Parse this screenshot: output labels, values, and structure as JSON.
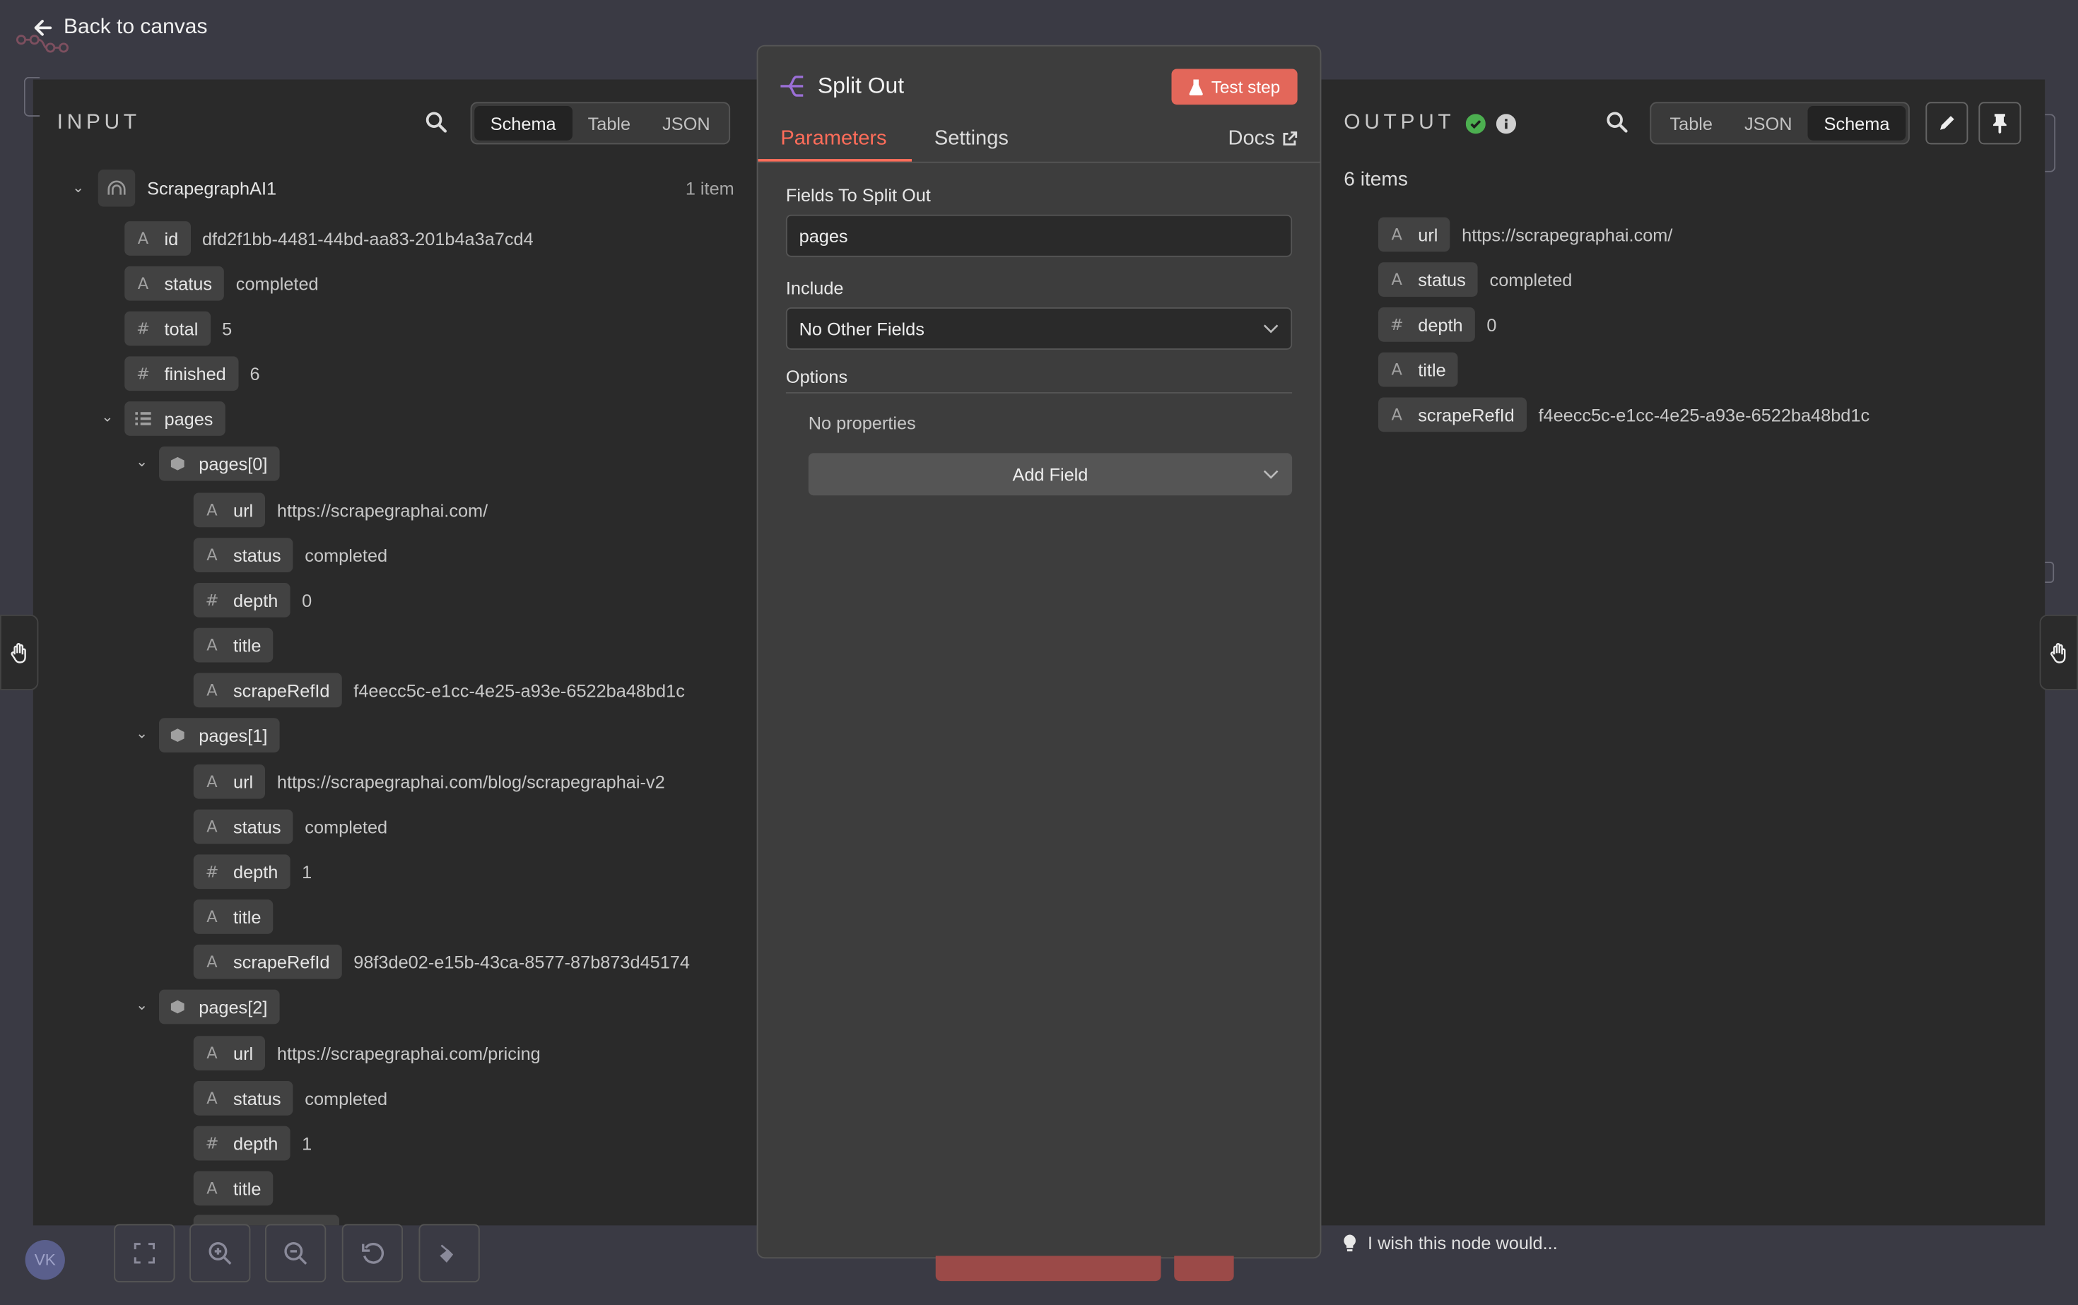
{
  "nav": {
    "back_label": "Back to canvas"
  },
  "input": {
    "header": "INPUT",
    "tabs": [
      "Schema",
      "Table",
      "JSON"
    ],
    "active_tab": "Schema",
    "root": {
      "name": "ScrapegraphAI1",
      "count": "1 item"
    },
    "fields": {
      "id": {
        "key": "id",
        "type": "A",
        "value": "dfd2f1bb-4481-44bd-aa83-201b4a3a7cd4"
      },
      "status": {
        "key": "status",
        "type": "A",
        "value": "completed"
      },
      "total": {
        "key": "total",
        "type": "#",
        "value": "5"
      },
      "finished": {
        "key": "finished",
        "type": "#",
        "value": "6"
      },
      "pages": {
        "key": "pages"
      }
    },
    "pages": [
      {
        "label": "pages[0]",
        "url": "https://scrapegraphai.com/",
        "status": "completed",
        "depth": "0",
        "scrapeRefId": "f4eecc5c-e1cc-4e25-a93e-6522ba48bd1c"
      },
      {
        "label": "pages[1]",
        "url": "https://scrapegraphai.com/blog/scrapegraphai-v2",
        "status": "completed",
        "depth": "1",
        "scrapeRefId": "98f3de02-e15b-43ca-8577-87b873d45174"
      },
      {
        "label": "pages[2]",
        "url": "https://scrapegraphai.com/pricing",
        "status": "completed",
        "depth": "1"
      }
    ],
    "keys": {
      "url": "url",
      "status": "status",
      "depth": "depth",
      "title": "title",
      "scrapeRefId": "scrapeRefId"
    },
    "types": {
      "string": "A",
      "number": "#"
    }
  },
  "node": {
    "title": "Split Out",
    "test_button": "Test step",
    "tabs": {
      "parameters": "Parameters",
      "settings": "Settings",
      "docs": "Docs"
    },
    "fields_label": "Fields To Split Out",
    "fields_value": "pages",
    "include_label": "Include",
    "include_value": "No Other Fields",
    "options_label": "Options",
    "no_properties": "No properties",
    "add_field": "Add Field"
  },
  "output": {
    "header": "OUTPUT",
    "tabs": [
      "Table",
      "JSON",
      "Schema"
    ],
    "active_tab": "Schema",
    "count": "6 items",
    "fields": [
      {
        "key": "url",
        "type": "A",
        "value": "https://scrapegraphai.com/"
      },
      {
        "key": "status",
        "type": "A",
        "value": "completed"
      },
      {
        "key": "depth",
        "type": "#",
        "value": "0"
      },
      {
        "key": "title",
        "type": "A",
        "value": ""
      },
      {
        "key": "scrapeRefId",
        "type": "A",
        "value": "f4eecc5c-e1cc-4e25-a93e-6522ba48bd1c"
      }
    ]
  },
  "footer": {
    "feedback": "I wish this node would...",
    "avatar": "VK"
  },
  "colors": {
    "accent": "#ff6d5a",
    "success": "#4caf50",
    "panel": "#2a2a2a",
    "background": "#3a3a44"
  }
}
